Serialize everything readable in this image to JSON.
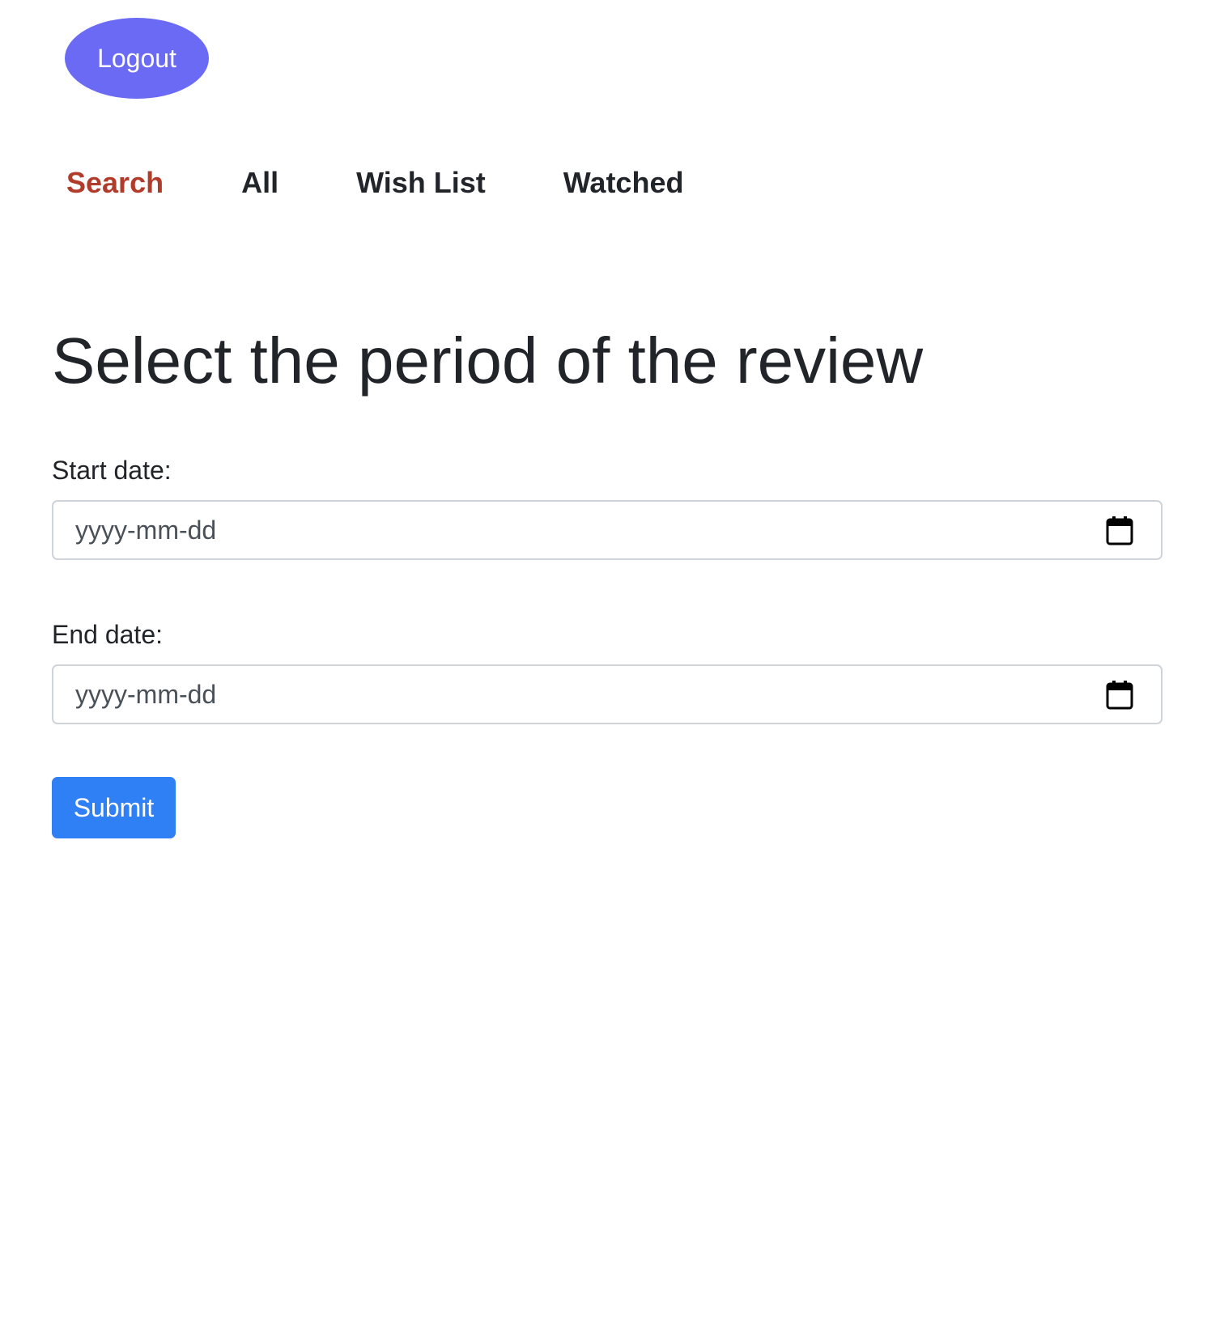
{
  "header": {
    "logout_label": "Logout"
  },
  "nav": {
    "items": [
      {
        "label": "Search",
        "active": true
      },
      {
        "label": "All",
        "active": false
      },
      {
        "label": "Wish List",
        "active": false
      },
      {
        "label": "Watched",
        "active": false
      }
    ],
    "active_color": "#b23c2c"
  },
  "form": {
    "title": "Select the period of the review",
    "start_label": "Start date:",
    "start_placeholder": "yyyy-mm-dd",
    "start_icon": "calendar-icon",
    "end_label": "End date:",
    "end_placeholder": "yyyy-mm-dd",
    "end_icon": "calendar-icon",
    "submit_label": "Submit"
  },
  "colors": {
    "logout_bg": "#6a6af4",
    "submit_bg": "#2f7ff5",
    "text": "#212529"
  }
}
